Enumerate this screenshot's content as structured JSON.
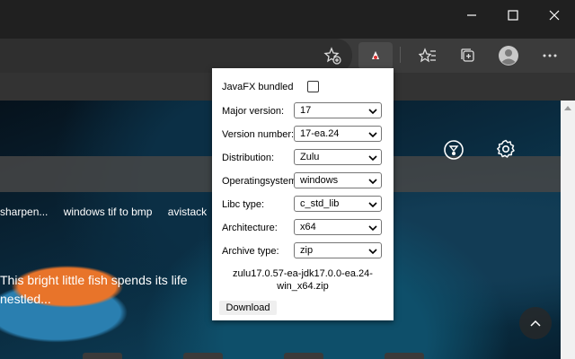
{
  "window": {
    "icons": [
      "minimize-icon",
      "maximize-icon",
      "close-icon"
    ]
  },
  "toolbar": {
    "icons": [
      "add-favorite-icon",
      "extension-icon",
      "favorites-icon",
      "collections-icon",
      "profile-icon",
      "more-icon"
    ]
  },
  "page": {
    "links": [
      "sharpen...",
      "windows tif to bmp",
      "avistack"
    ],
    "caption_line1": "This bright little fish spends its life",
    "caption_line2": "nestled..."
  },
  "popup": {
    "javafx_label": "JavaFX bundled",
    "javafx_checked": false,
    "fields": [
      {
        "label": "Major version:",
        "value": "17"
      },
      {
        "label": "Version number:",
        "value": "17-ea.24"
      },
      {
        "label": "Distribution:",
        "value": "Zulu"
      },
      {
        "label": "Operatingsystem:",
        "value": "windows"
      },
      {
        "label": "Libc type:",
        "value": "c_std_lib"
      },
      {
        "label": "Architecture:",
        "value": "x64"
      },
      {
        "label": "Archive type:",
        "value": "zip"
      }
    ],
    "filename_line1": "zulu17.0.57-ea-jdk17.0.0-ea.24-",
    "filename_line2": "win_x64.zip",
    "download_label": "Download"
  }
}
